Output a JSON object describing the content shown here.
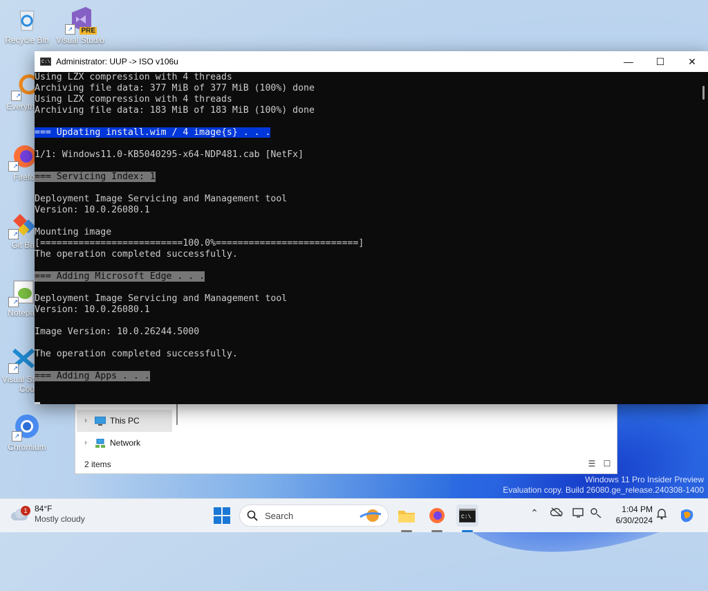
{
  "desktop": {
    "icons": [
      {
        "label": "Recycle Bin",
        "icon": "recycle-bin-icon"
      },
      {
        "label": "Visual Studio",
        "icon": "visual-studio-icon",
        "badge": "PRE"
      },
      {
        "label": "Everyth",
        "icon": "everything-search-icon"
      },
      {
        "label": "Firefo",
        "icon": "firefox-icon"
      },
      {
        "label": "Git Ba",
        "icon": "git-bash-icon"
      },
      {
        "label": "Notepa",
        "icon": "notepad-plus-plus-icon"
      },
      {
        "label": "Visual St",
        "label2": "Cod",
        "icon": "vscode-icon"
      },
      {
        "label": "Chromium",
        "icon": "chromium-icon"
      }
    ]
  },
  "terminal": {
    "title": "Administrator:  UUP -> ISO v106u",
    "lines": [
      {
        "text": "Using LZX compression with 4 threads",
        "style": ""
      },
      {
        "text": "Archiving file data: 377 MiB of 377 MiB (100%) done",
        "style": ""
      },
      {
        "text": "Using LZX compression with 4 threads",
        "style": ""
      },
      {
        "text": "Archiving file data: 183 MiB of 183 MiB (100%) done",
        "style": ""
      },
      {
        "text": "",
        "style": ""
      },
      {
        "text": "=== Updating install.wim / 4 image{s} . . .",
        "style": "blue"
      },
      {
        "text": "",
        "style": ""
      },
      {
        "text": "1/1: Windows11.0-KB5040295-x64-NDP481.cab [NetFx]",
        "style": ""
      },
      {
        "text": "",
        "style": ""
      },
      {
        "text": "=== Servicing Index: 1",
        "style": "gray"
      },
      {
        "text": "",
        "style": ""
      },
      {
        "text": "Deployment Image Servicing and Management tool",
        "style": ""
      },
      {
        "text": "Version: 10.0.26080.1",
        "style": ""
      },
      {
        "text": "",
        "style": ""
      },
      {
        "text": "Mounting image",
        "style": ""
      },
      {
        "text": "[==========================100.0%==========================]",
        "style": ""
      },
      {
        "text": "The operation completed successfully.",
        "style": ""
      },
      {
        "text": "",
        "style": ""
      },
      {
        "text": "=== Adding Microsoft Edge . . .",
        "style": "gray"
      },
      {
        "text": "",
        "style": ""
      },
      {
        "text": "Deployment Image Servicing and Management tool",
        "style": ""
      },
      {
        "text": "Version: 10.0.26080.1",
        "style": ""
      },
      {
        "text": "",
        "style": ""
      },
      {
        "text": "Image Version: 10.0.26244.5000",
        "style": ""
      },
      {
        "text": "",
        "style": ""
      },
      {
        "text": "The operation completed successfully.",
        "style": ""
      },
      {
        "text": "",
        "style": ""
      },
      {
        "text": "=== Adding Apps . . .",
        "style": "gray"
      },
      {
        "text": "",
        "style": ""
      },
      {
        "text": "",
        "style": "cursor"
      }
    ]
  },
  "explorer": {
    "nav": [
      {
        "label": "This PC",
        "icon": "this-pc-icon",
        "selected": true
      },
      {
        "label": "Network",
        "icon": "network-icon",
        "selected": false
      }
    ],
    "status": "2 items"
  },
  "watermark": {
    "line1": "Windows 11 Pro Insider Preview",
    "line2": "Evaluation copy. Build 26080.ge_release.240308-1400"
  },
  "taskbar": {
    "weather": {
      "temp": "84°F",
      "condition": "Mostly cloudy",
      "alert": "1"
    },
    "search_label": "Search",
    "time": "1:04 PM",
    "date": "6/30/2024"
  }
}
